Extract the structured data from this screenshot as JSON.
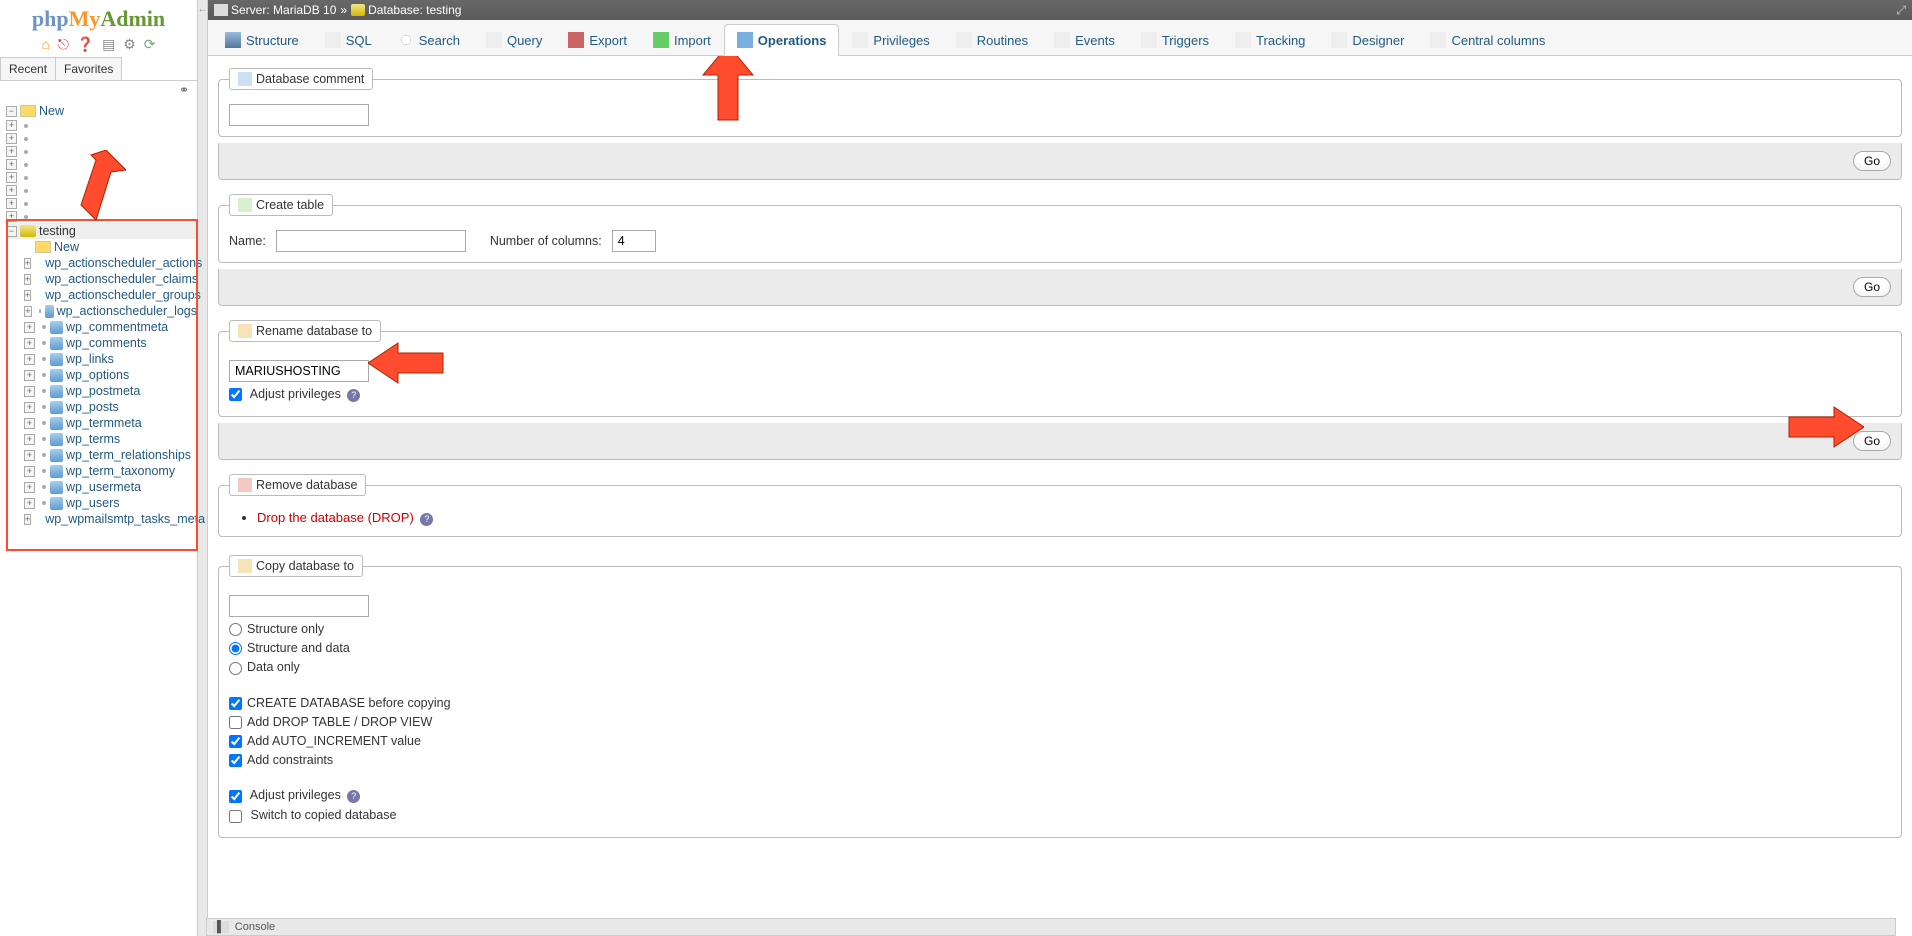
{
  "logo": {
    "php": "php",
    "my": "My",
    "admin": "Admin"
  },
  "sidebarTabs": {
    "recent": "Recent",
    "favorites": "Favorites"
  },
  "tree": {
    "new": "New",
    "selected_db": "testing",
    "db_new": "New",
    "tables": [
      "wp_actionscheduler_actions",
      "wp_actionscheduler_claims",
      "wp_actionscheduler_groups",
      "wp_actionscheduler_logs",
      "wp_commentmeta",
      "wp_comments",
      "wp_links",
      "wp_options",
      "wp_postmeta",
      "wp_posts",
      "wp_termmeta",
      "wp_terms",
      "wp_term_relationships",
      "wp_term_taxonomy",
      "wp_usermeta",
      "wp_users",
      "wp_wpmailsmtp_tasks_meta"
    ]
  },
  "breadcrumb": {
    "server_label": "Server:",
    "server_name": "MariaDB 10",
    "db_label": "Database:",
    "db_name": "testing"
  },
  "tabs": [
    {
      "label": "Structure",
      "icon": "i-struct"
    },
    {
      "label": "SQL",
      "icon": "i-sql"
    },
    {
      "label": "Search",
      "icon": "i-search"
    },
    {
      "label": "Query",
      "icon": "i-query"
    },
    {
      "label": "Export",
      "icon": "i-export"
    },
    {
      "label": "Import",
      "icon": "i-import"
    },
    {
      "label": "Operations",
      "icon": "i-ops",
      "active": true
    },
    {
      "label": "Privileges",
      "icon": "i-priv"
    },
    {
      "label": "Routines",
      "icon": "i-rout"
    },
    {
      "label": "Events",
      "icon": "i-evt"
    },
    {
      "label": "Triggers",
      "icon": "i-trig"
    },
    {
      "label": "Tracking",
      "icon": "i-track"
    },
    {
      "label": "Designer",
      "icon": "i-des"
    },
    {
      "label": "Central columns",
      "icon": "i-cols"
    }
  ],
  "sections": {
    "db_comment": {
      "legend": "Database comment",
      "value": "",
      "go": "Go"
    },
    "create_table": {
      "legend": "Create table",
      "name_label": "Name:",
      "name_value": "",
      "cols_label": "Number of columns:",
      "cols_value": "4",
      "go": "Go"
    },
    "rename": {
      "legend": "Rename database to",
      "value": "MARIUSHOSTING",
      "adjust_label": "Adjust privileges",
      "adjust_checked": true,
      "go": "Go"
    },
    "remove": {
      "legend": "Remove database",
      "drop_text": "Drop the database (DROP)"
    },
    "copy": {
      "legend": "Copy database to",
      "value": "",
      "opts": [
        {
          "label": "Structure only",
          "type": "radio",
          "checked": false
        },
        {
          "label": "Structure and data",
          "type": "radio",
          "checked": true
        },
        {
          "label": "Data only",
          "type": "radio",
          "checked": false
        }
      ],
      "checks": [
        {
          "label": "CREATE DATABASE before copying",
          "checked": true
        },
        {
          "label": "Add DROP TABLE / DROP VIEW",
          "checked": false
        },
        {
          "label": "Add AUTO_INCREMENT value",
          "checked": true
        },
        {
          "label": "Add constraints",
          "checked": true
        }
      ],
      "adjust_label": "Adjust privileges",
      "adjust_checked": true,
      "switch_label": "Switch to copied database",
      "switch_checked": false
    }
  },
  "console": "Console"
}
